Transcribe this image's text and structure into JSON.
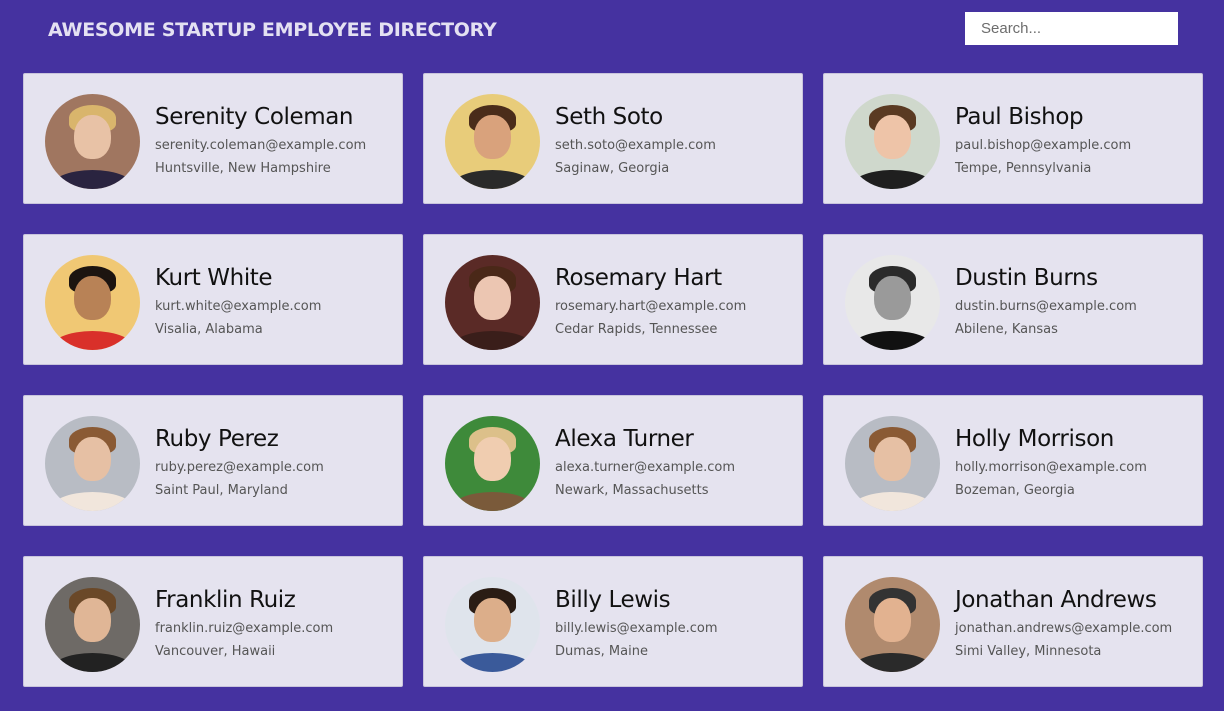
{
  "header": {
    "title": "AWESOME STARTUP EMPLOYEE DIRECTORY",
    "search_placeholder": "Search..."
  },
  "colors": {
    "page_background": "#4532a0",
    "card_background": "#e5e3ef",
    "title_text": "#e4e1f2"
  },
  "employees": [
    {
      "name": "Serenity Coleman",
      "email": "serenity.coleman@example.com",
      "location": "Huntsville, New Hampshire",
      "avatar": {
        "bg": "#a07660",
        "face": "#e8c2a6",
        "hair": "#d9b56c",
        "shirt": "#2a2440"
      }
    },
    {
      "name": "Seth Soto",
      "email": "seth.soto@example.com",
      "location": "Saginaw, Georgia",
      "avatar": {
        "bg": "#e8cc7a",
        "face": "#d9a27c",
        "hair": "#4a2c1a",
        "shirt": "#2a2a2a"
      }
    },
    {
      "name": "Paul Bishop",
      "email": "paul.bishop@example.com",
      "location": "Tempe, Pennsylvania",
      "avatar": {
        "bg": "#cfd8cc",
        "face": "#eec4a8",
        "hair": "#5a3a22",
        "shirt": "#1f1f1f"
      }
    },
    {
      "name": "Kurt White",
      "email": "kurt.white@example.com",
      "location": "Visalia, Alabama",
      "avatar": {
        "bg": "#f0c874",
        "face": "#b88256",
        "hair": "#1c1410",
        "shirt": "#d9302a"
      }
    },
    {
      "name": "Rosemary Hart",
      "email": "rosemary.hart@example.com",
      "location": "Cedar Rapids, Tennessee",
      "avatar": {
        "bg": "#5a2a26",
        "face": "#ecc6b2",
        "hair": "#4a2818",
        "shirt": "#3a1e1a"
      }
    },
    {
      "name": "Dustin Burns",
      "email": "dustin.burns@example.com",
      "location": "Abilene, Kansas",
      "avatar": {
        "bg": "#e8e8e8",
        "face": "#9a9a9a",
        "hair": "#2a2a2a",
        "shirt": "#111111"
      }
    },
    {
      "name": "Ruby Perez",
      "email": "ruby.perez@example.com",
      "location": "Saint Paul, Maryland",
      "avatar": {
        "bg": "#b8bcc4",
        "face": "#e6c0a4",
        "hair": "#8a5a34",
        "shirt": "#f1e6dc"
      }
    },
    {
      "name": "Alexa Turner",
      "email": "alexa.turner@example.com",
      "location": "Newark, Massachusetts",
      "avatar": {
        "bg": "#3e8a3a",
        "face": "#f0cdb0",
        "hair": "#dcc08a",
        "shirt": "#7a5a3a"
      }
    },
    {
      "name": "Holly Morrison",
      "email": "holly.morrison@example.com",
      "location": "Bozeman, Georgia",
      "avatar": {
        "bg": "#b8bcc4",
        "face": "#e6c0a4",
        "hair": "#8a5a34",
        "shirt": "#f1e6dc"
      }
    },
    {
      "name": "Franklin Ruiz",
      "email": "franklin.ruiz@example.com",
      "location": "Vancouver, Hawaii",
      "avatar": {
        "bg": "#6e6a66",
        "face": "#e0b696",
        "hair": "#6a4828",
        "shirt": "#222222"
      }
    },
    {
      "name": "Billy Lewis",
      "email": "billy.lewis@example.com",
      "location": "Dumas, Maine",
      "avatar": {
        "bg": "#dfe4ec",
        "face": "#dcae8a",
        "hair": "#2a1c14",
        "shirt": "#3a5a9a"
      }
    },
    {
      "name": "Jonathan Andrews",
      "email": "jonathan.andrews@example.com",
      "location": "Simi Valley, Minnesota",
      "avatar": {
        "bg": "#b08a6e",
        "face": "#e2b290",
        "hair": "#333333",
        "shirt": "#2a2a2a"
      }
    }
  ]
}
